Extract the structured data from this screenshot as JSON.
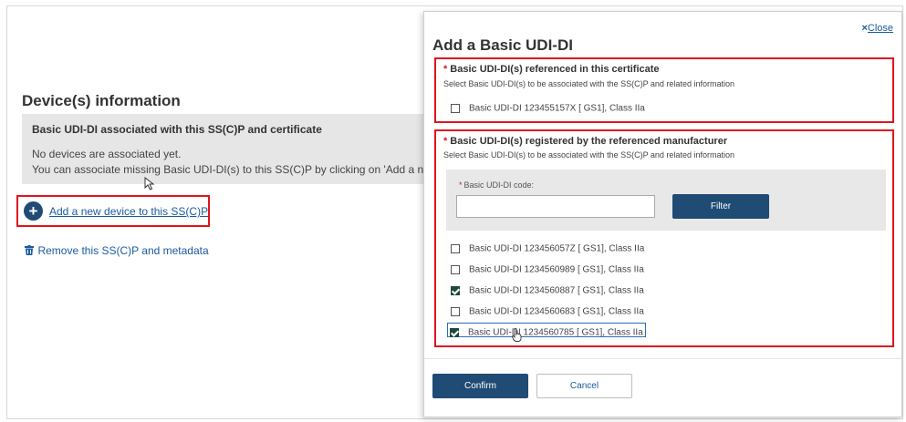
{
  "page": {
    "section_title": "Device(s) information",
    "panel": {
      "heading": "Basic UDI-DI associated with this SS(C)P and certificate",
      "line1": "No devices are associated yet.",
      "line2": "You can associate missing Basic UDI-DI(s) to this SS(C)P by clicking on 'Add a new"
    },
    "add_device_link": "Add a new device to this SS(C)P",
    "remove_link": "Remove this SS(C)P and metadata"
  },
  "modal": {
    "close_x": "×",
    "close_label": "Close",
    "title": "Add a Basic UDI-DI",
    "section1": {
      "required_mark": "*",
      "heading": "Basic UDI-DI(s) referenced in this certificate",
      "subtext": "Select Basic UDI-DI(s) to be associated with the SS(C)P and related information",
      "items": [
        {
          "label": "Basic UDI-DI 123455157X [ GS1],   Class IIa",
          "checked": false
        }
      ]
    },
    "section2": {
      "required_mark": "*",
      "heading": "Basic UDI-DI(s) registered by the referenced manufacturer",
      "subtext": "Select Basic UDI-DI(s) to be associated with the SS(C)P and related information",
      "filter": {
        "required_mark": "*",
        "code_label": "Basic UDI-DI code:",
        "code_value": "",
        "filter_button": "Filter"
      },
      "items": [
        {
          "label": "Basic UDI-DI 123456057Z [ GS1],   Class IIa",
          "checked": false
        },
        {
          "label": "Basic UDI-DI 1234560989 [ GS1],   Class IIa",
          "checked": false
        },
        {
          "label": "Basic UDI-DI 1234560887 [ GS1],   Class IIa",
          "checked": true
        },
        {
          "label": "Basic UDI-DI 1234560683 [ GS1],   Class IIa",
          "checked": false
        },
        {
          "label": "Basic UDI-DI 1234560785 [ GS1],   Class IIa",
          "checked": true
        }
      ]
    },
    "confirm_button": "Confirm",
    "cancel_button": "Cancel"
  },
  "colors": {
    "primary": "#1f4b74",
    "link": "#1a5aa0",
    "highlight_border": "#e0141e",
    "panel_bg": "#e6e6e6"
  },
  "icons": [
    "plus-circle-icon",
    "trash-icon",
    "close-icon",
    "checkbox-icon",
    "pointer-arrow-icon",
    "hand-cursor-icon"
  ]
}
